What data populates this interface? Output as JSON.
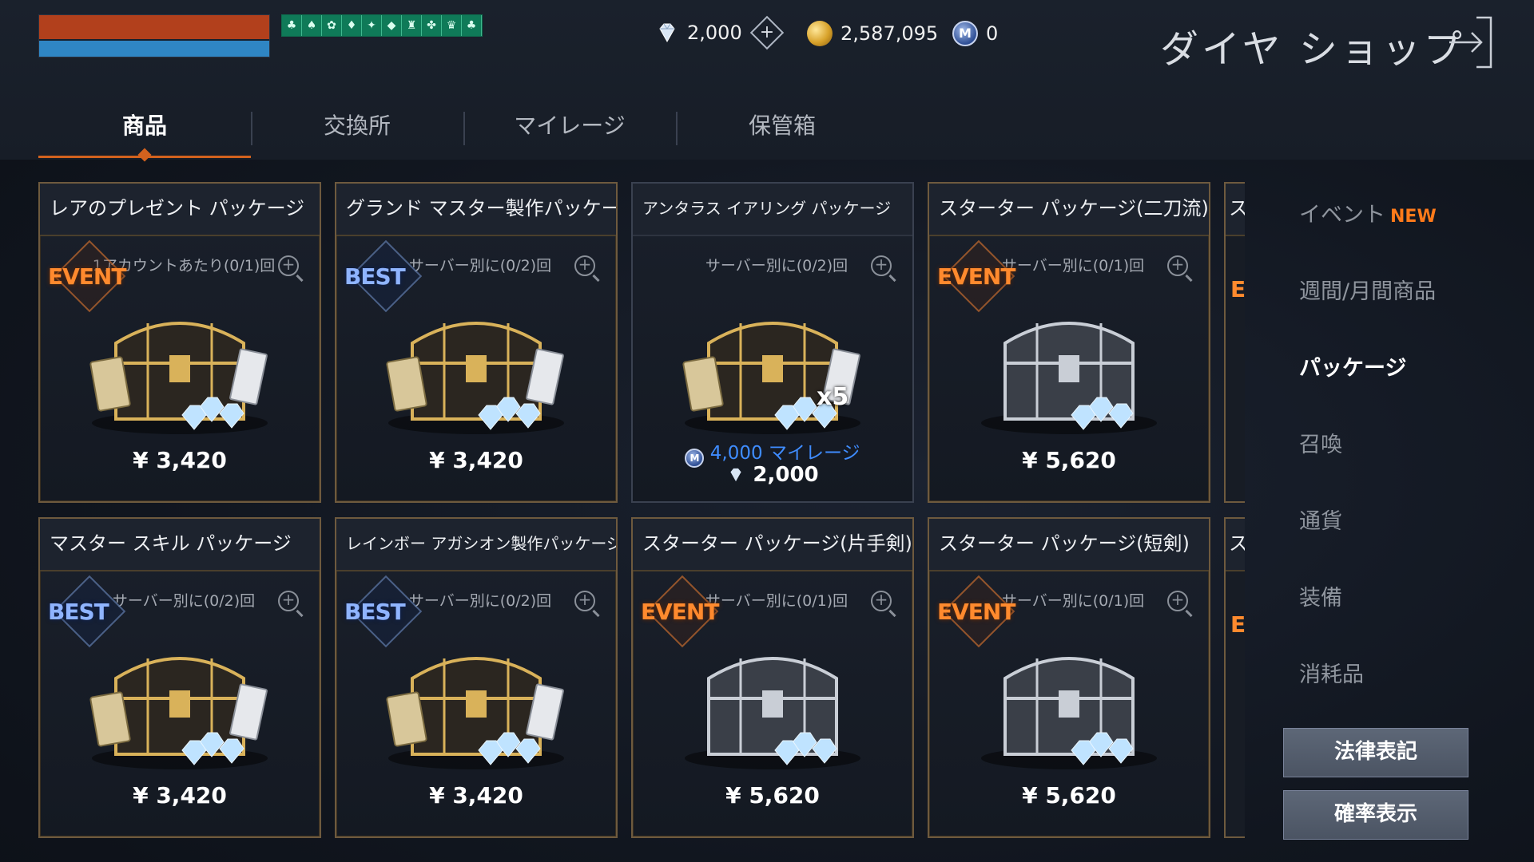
{
  "currency": {
    "diamonds": "2,000",
    "gold": "2,587,095",
    "mileage": "0",
    "mileage_icon_letter": "M"
  },
  "header": {
    "title": "ダイヤ ショップ"
  },
  "tabs": [
    "商品",
    "交換所",
    "マイレージ",
    "保管箱"
  ],
  "buffs": [
    "♣",
    "♠",
    "✿",
    "♦",
    "✦",
    "◆",
    "♜",
    "✤",
    "♛",
    "♣"
  ],
  "cards": [
    {
      "title": "レアのプレゼント パッケージ",
      "limit": "1アカウントあたり(0/1)回",
      "badge": "EVENT",
      "price": "¥ 3,420"
    },
    {
      "title": "グランド マスター製作パッケージ",
      "limit": "サーバー別に(0/2)回",
      "badge": "BEST",
      "price": "¥ 3,420"
    },
    {
      "title": "アンタラス イアリング パッケージ",
      "limit": "サーバー別に(0/2)回",
      "badge": "",
      "mileage": "4,000 マイレージ",
      "dia_price": "2,000",
      "qty": "x5"
    },
    {
      "title": "スターター パッケージ(二刀流)",
      "limit": "サーバー別に(0/1)回",
      "badge": "EVENT",
      "price": "¥ 5,620"
    },
    {
      "title": "マスター スキル パッケージ",
      "limit": "サーバー別に(0/2)回",
      "badge": "BEST",
      "price": "¥ 3,420"
    },
    {
      "title": "レインボー アガシオン製作パッケージ",
      "limit": "サーバー別に(0/2)回",
      "badge": "BEST",
      "price": "¥ 3,420"
    },
    {
      "title": "スターター パッケージ(片手剣)",
      "limit": "サーバー別に(0/1)回",
      "badge": "EVENT",
      "price": "¥ 5,620"
    },
    {
      "title": "スターター パッケージ(短剣)",
      "limit": "サーバー別に(0/1)回",
      "badge": "EVENT",
      "price": "¥ 5,620"
    }
  ],
  "partial": {
    "title_glyph": "ス",
    "badge_glyph": "E"
  },
  "sidebar": {
    "items": [
      "イベント",
      "週間/月間商品",
      "パッケージ",
      "召喚",
      "通貨",
      "装備",
      "消耗品"
    ],
    "new_tag": "NEW",
    "active": "パッケージ"
  },
  "buttons": {
    "legal": "法律表記",
    "probability": "確率表示"
  },
  "colors": {
    "accent": "#d3621e",
    "event": "#ff8a2e",
    "best": "#8fb4ff",
    "mileage": "#3f8cff"
  }
}
